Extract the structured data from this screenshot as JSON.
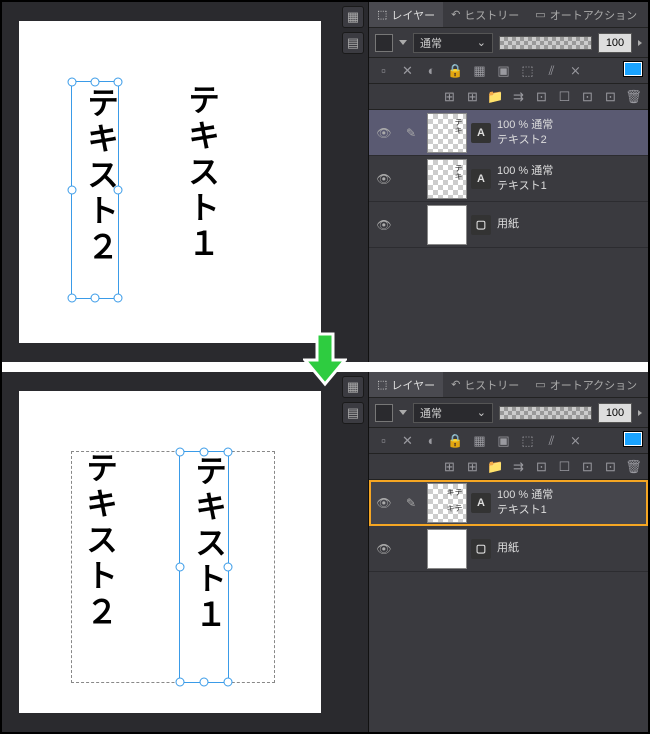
{
  "tabs": {
    "layer": "レイヤー",
    "history": "ヒストリー",
    "autoaction": "オートアクション"
  },
  "blendMode": "通常",
  "opacity": "100",
  "iconbar1": [
    "▢",
    "✕",
    "🔒",
    "🔒",
    "▦",
    "▣",
    "⬚",
    "⫽",
    "⨯",
    "⫽"
  ],
  "iconbar2": [
    "⊞",
    "⊞",
    "📁",
    "⇉",
    "⊡",
    "☐",
    "⊡",
    "⊡",
    "🗑"
  ],
  "scene_top": {
    "canvas": {
      "text1": "テキスト１",
      "text2": "テキスト２"
    },
    "layers": [
      {
        "opacity": "100 % 通常",
        "name": "テキスト2",
        "type": "text",
        "selected": true
      },
      {
        "opacity": "100 % 通常",
        "name": "テキスト1",
        "type": "text",
        "selected": false
      },
      {
        "opacity": "",
        "name": "用紙",
        "type": "paper",
        "selected": false
      }
    ]
  },
  "scene_bottom": {
    "canvas": {
      "text1": "テキスト１",
      "text2": "テキスト２"
    },
    "layers": [
      {
        "opacity": "100 % 通常",
        "name": "テキスト1",
        "type": "text",
        "highlighted": true
      },
      {
        "opacity": "",
        "name": "用紙",
        "type": "paper"
      }
    ]
  }
}
